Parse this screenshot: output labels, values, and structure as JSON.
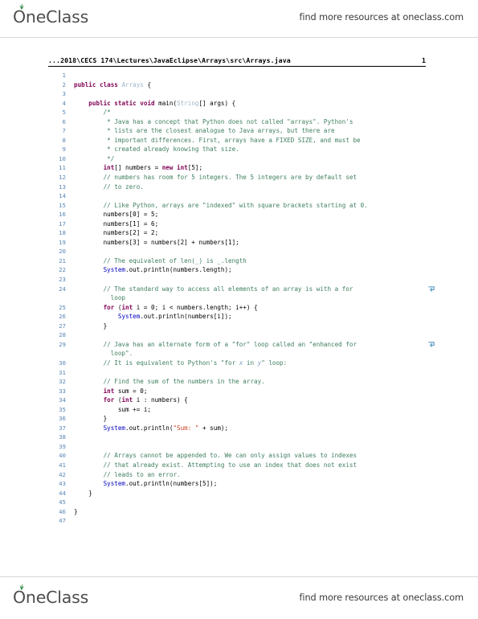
{
  "brand": {
    "logo_text": "OneClass",
    "tagline": "find more resources at oneclass.com",
    "leaf_color": "#2e8b45",
    "logo_color": "#4d4d4d"
  },
  "document": {
    "path": "...2018\\CECS 174\\Lectures\\JavaEclipse\\Arrays\\src\\Arrays.java",
    "page_number": "1",
    "language": "java",
    "total_lines": 47
  },
  "colors": {
    "keyword": "#7f0055",
    "comment": "#3f7f5f",
    "string": "#cc4125",
    "class_name": "#9fb6c9",
    "static_field": "#0000c0",
    "line_number": "#5b87b5",
    "wrap_marker": "#5e9ec4",
    "plain": "#000000"
  },
  "icons": {
    "wrap_marker": "line-wrap-arrow-icon",
    "leaf": "leaf-icon"
  },
  "code_lines": [
    {
      "n": "1",
      "text": ""
    },
    {
      "n": "2",
      "text": "public class Arrays {"
    },
    {
      "n": "3",
      "text": ""
    },
    {
      "n": "4",
      "text": "    public static void main(String[] args) {"
    },
    {
      "n": "5",
      "text": "        /*"
    },
    {
      "n": "6",
      "text": "         * Java has a concept that Python does not called \"arrays\". Python's"
    },
    {
      "n": "7",
      "text": "         * lists are the closest analogue to Java arrays, but there are"
    },
    {
      "n": "8",
      "text": "         * important differences. First, arrays have a FIXED SIZE, and must be"
    },
    {
      "n": "9",
      "text": "         * created already knowing that size."
    },
    {
      "n": "10",
      "text": "         */"
    },
    {
      "n": "11",
      "text": "        int[] numbers = new int[5];"
    },
    {
      "n": "12",
      "text": "        // numbers has room for 5 integers. The 5 integers are by default set"
    },
    {
      "n": "13",
      "text": "        // to zero."
    },
    {
      "n": "14",
      "text": ""
    },
    {
      "n": "15",
      "text": "        // Like Python, arrays are \"indexed\" with square brackets starting at 0."
    },
    {
      "n": "16",
      "text": "        numbers[0] = 5;"
    },
    {
      "n": "17",
      "text": "        numbers[1] = 6;"
    },
    {
      "n": "18",
      "text": "        numbers[2] = 2;"
    },
    {
      "n": "19",
      "text": "        numbers[3] = numbers[2] + numbers[1];"
    },
    {
      "n": "20",
      "text": ""
    },
    {
      "n": "21",
      "text": "        // The equivalent of len(_) is _.length"
    },
    {
      "n": "22",
      "text": "        System.out.println(numbers.length);"
    },
    {
      "n": "23",
      "text": ""
    },
    {
      "n": "24",
      "text": "        // The standard way to access all elements of an array is with a for"
    },
    {
      "n": "24b",
      "text": "          loop",
      "continuation": true
    },
    {
      "n": "25",
      "text": "        for (int i = 0; i < numbers.length; i++) {"
    },
    {
      "n": "26",
      "text": "            System.out.println(numbers[i]);"
    },
    {
      "n": "27",
      "text": "        }"
    },
    {
      "n": "28",
      "text": ""
    },
    {
      "n": "29",
      "text": "        // Java has an alternate form of a \"for\" loop called an \"enhanced for"
    },
    {
      "n": "29b",
      "text": "          loop\".",
      "continuation": true
    },
    {
      "n": "30",
      "text": "        // It is equivalent to Python's \"for x in y\" loop:"
    },
    {
      "n": "31",
      "text": ""
    },
    {
      "n": "32",
      "text": "        // Find the sum of the numbers in the array."
    },
    {
      "n": "33",
      "text": "        int sum = 0;"
    },
    {
      "n": "34",
      "text": "        for (int i : numbers) {"
    },
    {
      "n": "35",
      "text": "            sum += i;"
    },
    {
      "n": "36",
      "text": "        }"
    },
    {
      "n": "37",
      "text": "        System.out.println(\"Sum: \" + sum);"
    },
    {
      "n": "38",
      "text": ""
    },
    {
      "n": "39",
      "text": ""
    },
    {
      "n": "40",
      "text": "        // Arrays cannot be appended to. We can only assign values to indexes"
    },
    {
      "n": "41",
      "text": "        // that already exist. Attempting to use an index that does not exist"
    },
    {
      "n": "42",
      "text": "        // leads to an error."
    },
    {
      "n": "43",
      "text": "        System.out.println(numbers[5]);"
    },
    {
      "n": "44",
      "text": "    }"
    },
    {
      "n": "45",
      "text": ""
    },
    {
      "n": "46",
      "text": "}"
    },
    {
      "n": "47",
      "text": ""
    }
  ],
  "code_html": [
    {
      "n": "1",
      "html": ""
    },
    {
      "n": "2",
      "html": "<span class=\"kw\">public class</span> <span class=\"cls\">Arrays</span> {"
    },
    {
      "n": "3",
      "html": ""
    },
    {
      "n": "4",
      "html": "    <span class=\"kw\">public static void</span> main(<span class=\"cls\">String</span>[] args) {"
    },
    {
      "n": "5",
      "html": "        <span class=\"cm\">/*</span>"
    },
    {
      "n": "6",
      "html": "         <span class=\"cm\">* Java has a concept that Python does not called \"arrays\". Python's</span>"
    },
    {
      "n": "7",
      "html": "         <span class=\"cm\">* lists are the closest analogue to Java arrays, but there are</span>"
    },
    {
      "n": "8",
      "html": "         <span class=\"cm\">* important differences. First, arrays have a FIXED SIZE, and must be</span>"
    },
    {
      "n": "9",
      "html": "         <span class=\"cm\">* created already knowing that size.</span>"
    },
    {
      "n": "10",
      "html": "         <span class=\"cm\">*/</span>"
    },
    {
      "n": "11",
      "html": "        <span class=\"kw\">int</span>[] numbers = <span class=\"kw\">new int</span>[<span class=\"pl\">5</span>];"
    },
    {
      "n": "12",
      "html": "        <span class=\"cm\">// numbers has room for 5 integers. The 5 integers are by default set</span>"
    },
    {
      "n": "13",
      "html": "        <span class=\"cm\">// to zero.</span>"
    },
    {
      "n": "14",
      "html": ""
    },
    {
      "n": "15",
      "html": "        <span class=\"cm\">// Like Python, arrays are \"indexed\" with square brackets starting at 0.</span>"
    },
    {
      "n": "16",
      "html": "        numbers[0] = 5;"
    },
    {
      "n": "17",
      "html": "        numbers[1] = 6;"
    },
    {
      "n": "18",
      "html": "        numbers[2] = 2;"
    },
    {
      "n": "19",
      "html": "        numbers[3] = numbers[2] + numbers[1];"
    },
    {
      "n": "20",
      "html": ""
    },
    {
      "n": "21",
      "html": "        <span class=\"cm\">// The equivalent of len(_) is _.length</span>"
    },
    {
      "n": "22",
      "html": "        <span class=\"fld\">System</span>.out.println(numbers.length);"
    },
    {
      "n": "23",
      "html": ""
    },
    {
      "n": "24",
      "html": "        <span class=\"cm\">// The standard way to access all elements of an array is with a for</span>",
      "wrap": true
    },
    {
      "n": "24b",
      "html": "          <span class=\"cm\">loop</span>",
      "continuation": true
    },
    {
      "n": "25",
      "html": "        <span class=\"kw\">for</span> (<span class=\"kw\">int</span> i = 0; i &lt; numbers.length; i++) {"
    },
    {
      "n": "26",
      "html": "            <span class=\"fld\">System</span>.out.println(numbers[i]);"
    },
    {
      "n": "27",
      "html": "        }"
    },
    {
      "n": "28",
      "html": ""
    },
    {
      "n": "29",
      "html": "        <span class=\"cm\">// Java has an alternate form of a \"for\" loop called an \"enhanced for</span>",
      "wrap": true
    },
    {
      "n": "29b",
      "html": "          <span class=\"cm\">loop\".</span>",
      "continuation": true
    },
    {
      "n": "30",
      "html": "        <span class=\"cm\">// It is equivalent to Python's \"for </span><span class=\"cmi\">x</span><span class=\"cm\"> in </span><span class=\"cmi\">y</span><span class=\"cm\">\" loop:</span>"
    },
    {
      "n": "31",
      "html": ""
    },
    {
      "n": "32",
      "html": "        <span class=\"cm\">// Find the sum of the numbers in the array.</span>"
    },
    {
      "n": "33",
      "html": "        <span class=\"kw\">int</span> sum = 0;"
    },
    {
      "n": "34",
      "html": "        <span class=\"kw\">for</span> (<span class=\"kw\">int</span> i : numbers) {"
    },
    {
      "n": "35",
      "html": "            sum += i;"
    },
    {
      "n": "36",
      "html": "        }"
    },
    {
      "n": "37",
      "html": "        <span class=\"fld\">System</span>.out.println(<span class=\"str\">\"Sum: \"</span> + sum);"
    },
    {
      "n": "38",
      "html": ""
    },
    {
      "n": "39",
      "html": ""
    },
    {
      "n": "40",
      "html": "        <span class=\"cm\">// Arrays cannot be appended to. We can only assign values to indexes</span>"
    },
    {
      "n": "41",
      "html": "        <span class=\"cm\">// that already exist. Attempting to use an index that does not exist</span>"
    },
    {
      "n": "42",
      "html": "        <span class=\"cm\">// leads to an error.</span>"
    },
    {
      "n": "43",
      "html": "        <span class=\"fld\">System</span>.out.println(numbers[5]);"
    },
    {
      "n": "44",
      "html": "    }"
    },
    {
      "n": "45",
      "html": ""
    },
    {
      "n": "46",
      "html": "}"
    },
    {
      "n": "47",
      "html": ""
    }
  ]
}
